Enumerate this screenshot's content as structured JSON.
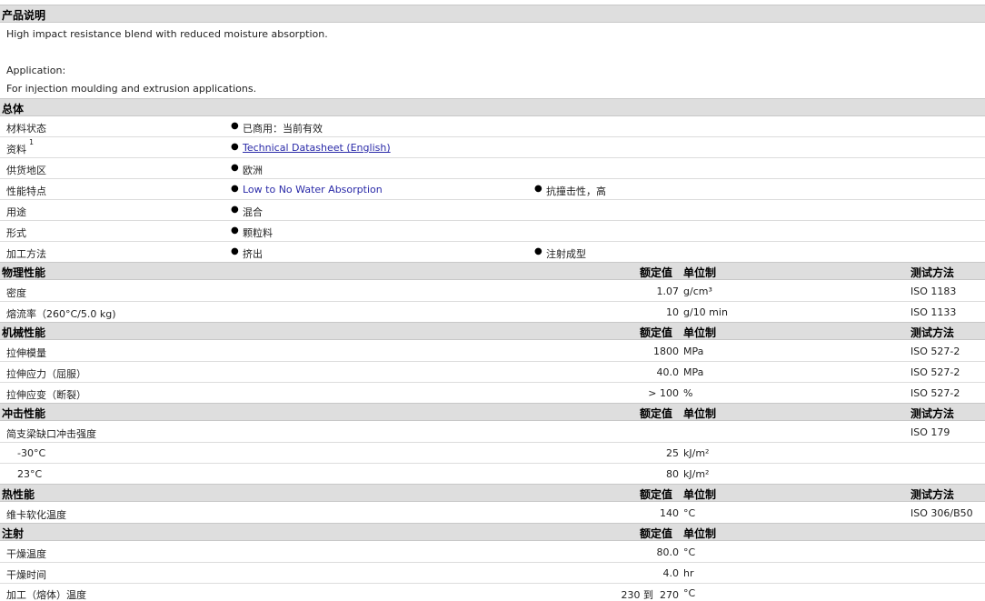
{
  "product_description": {
    "title": "产品说明",
    "line1": "High impact resistance blend with reduced moisture absorption.",
    "line2": "Application:",
    "line3": "For injection moulding and extrusion applications."
  },
  "general": {
    "title": "总体",
    "rows": [
      {
        "label": "材料状态",
        "items": [
          "已商用：当前有效"
        ]
      },
      {
        "label": "资料",
        "sup": "1",
        "items": [
          "Technical Datasheet (English)"
        ]
      },
      {
        "label": "供货地区",
        "items": [
          "欧洲"
        ]
      },
      {
        "label": "性能特点",
        "items": [
          "Low to No Water Absorption",
          "抗撞击性，高"
        ]
      },
      {
        "label": "用途",
        "items": [
          "混合"
        ]
      },
      {
        "label": "形式",
        "items": [
          "颗粒料"
        ]
      },
      {
        "label": "加工方法",
        "items": [
          "挤出",
          "注射成型"
        ]
      }
    ]
  },
  "headers": {
    "nominal": "额定值",
    "unit": "单位制",
    "test": "测试方法"
  },
  "physical": {
    "title": "物理性能",
    "rows": [
      {
        "label": "密度",
        "value": "1.07",
        "unit": "g/cm³",
        "test": "ISO 1183"
      },
      {
        "label": "熔流率（260°C/5.0 kg)",
        "value": "10",
        "unit": "g/10 min",
        "test": "ISO 1133"
      }
    ]
  },
  "mechanical": {
    "title": "机械性能",
    "rows": [
      {
        "label": "拉伸模量",
        "value": "1800",
        "unit": "MPa",
        "test": "ISO 527-2"
      },
      {
        "label": "拉伸应力（屈服）",
        "value": "40.0",
        "unit": "MPa",
        "test": "ISO 527-2"
      },
      {
        "label": "拉伸应变（断裂）",
        "value": "> 100",
        "unit": "%",
        "test": "ISO 527-2"
      }
    ]
  },
  "impact": {
    "title": "冲击性能",
    "rows": [
      {
        "label": "简支梁缺口冲击强度",
        "value": "",
        "unit": "",
        "test": "ISO 179"
      },
      {
        "label": "-30°C",
        "value": "25",
        "unit": "kJ/m²",
        "test": ""
      },
      {
        "label": "23°C",
        "value": "80",
        "unit": "kJ/m²",
        "test": ""
      }
    ]
  },
  "thermal": {
    "title": "热性能",
    "rows": [
      {
        "label": "维卡软化温度",
        "value": "140",
        "unit": "°C",
        "test": "ISO 306/B50"
      }
    ]
  },
  "injection": {
    "title": "注射",
    "rows": [
      {
        "label": "干燥温度",
        "value": "80.0",
        "unit": "°C"
      },
      {
        "label": "干燥时间",
        "value": "4.0",
        "unit": "hr"
      },
      {
        "label": "加工（熔体）温度",
        "value": "230 到  270",
        "unit": "°C"
      }
    ]
  }
}
